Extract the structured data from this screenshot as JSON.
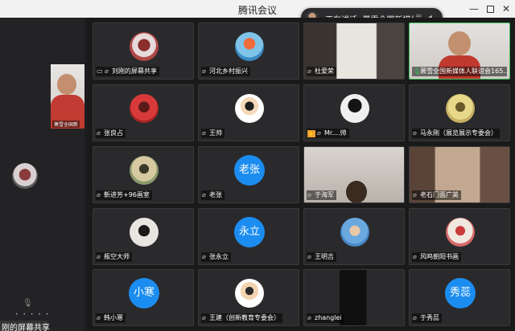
{
  "window": {
    "title": "腾讯会议",
    "minimize": "—",
    "close": "✕"
  },
  "speaking": {
    "text": "正在讲话: 萧雪全国新媒体..."
  },
  "left_panel": {
    "thumb_label": "萧雪全国新",
    "caption": "刚的屏幕共享"
  },
  "tiles": [
    {
      "name": "刘刚的屏幕共享",
      "kind": "avatar",
      "icon": "screen-share-icon",
      "mic": "muted"
    },
    {
      "name": "河北乡村振兴",
      "kind": "avatar",
      "mic": "muted"
    },
    {
      "name": "杜爱荣",
      "kind": "video",
      "mic": "muted"
    },
    {
      "name": "萧雪全国新媒体人联谊会165...",
      "kind": "video",
      "mic": "on"
    },
    {
      "name": "张良占",
      "kind": "avatar",
      "mic": "muted"
    },
    {
      "name": "王帅",
      "kind": "avatar",
      "mic": "muted"
    },
    {
      "name": "Mr....帅",
      "kind": "avatar",
      "mic": "muted",
      "hand": true
    },
    {
      "name": "马永刚（展览展示专委会）",
      "kind": "avatar",
      "mic": "muted"
    },
    {
      "name": "靳进芳+96画室",
      "kind": "avatar",
      "mic": "muted"
    },
    {
      "name": "老张",
      "kind": "text",
      "avatar_text": "老张",
      "mic": "muted"
    },
    {
      "name": "于海军",
      "kind": "video",
      "mic": "muted"
    },
    {
      "name": "老石门面广英",
      "kind": "video",
      "mic": "muted"
    },
    {
      "name": "瓶空大师",
      "kind": "avatar",
      "mic": "muted"
    },
    {
      "name": "张永立",
      "kind": "text",
      "avatar_text": "永立",
      "mic": "muted"
    },
    {
      "name": "王明吉",
      "kind": "avatar",
      "mic": "muted"
    },
    {
      "name": "风鸣朝阳书画",
      "kind": "avatar",
      "mic": "muted"
    },
    {
      "name": "韩小寒",
      "kind": "text",
      "avatar_text": "小寒",
      "mic": "muted"
    },
    {
      "name": "王建（创新教育专委会）",
      "kind": "avatar",
      "mic": "muted"
    },
    {
      "name": "zhanglei",
      "kind": "video",
      "mic": "muted"
    },
    {
      "name": "于秀蕊",
      "kind": "text",
      "avatar_text": "秀蕊",
      "mic": "muted"
    }
  ],
  "colors": {
    "text_avatar_bg": "#1c8df0",
    "active_border": "#3fbf5a",
    "mic_on": "#35c35a"
  }
}
